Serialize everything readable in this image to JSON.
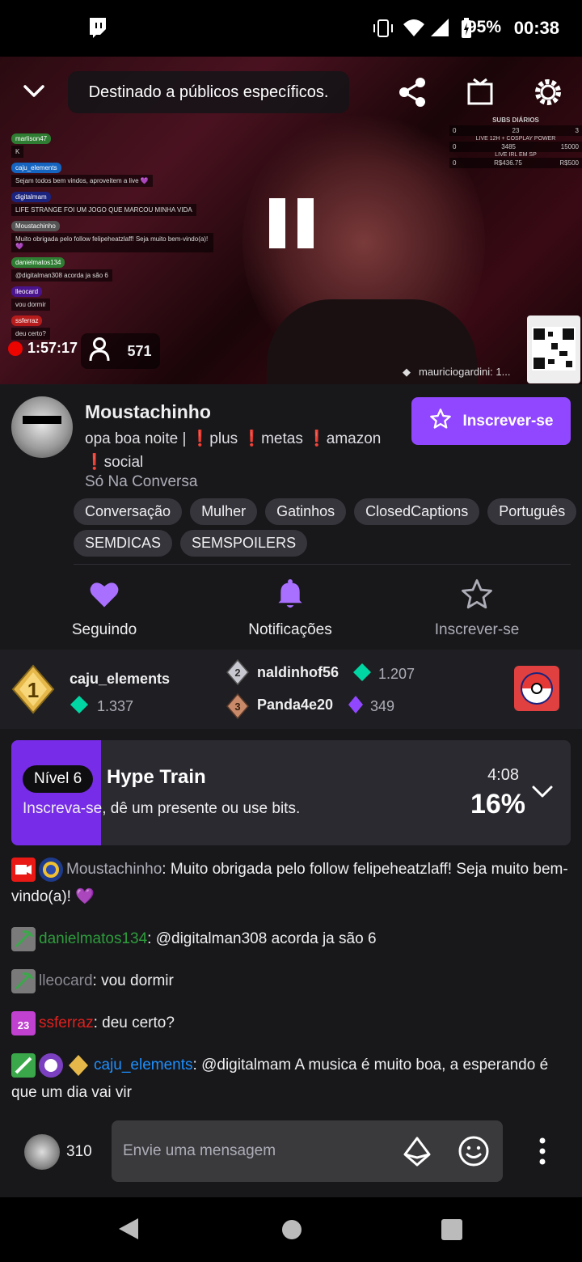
{
  "status_bar": {
    "battery": "95%",
    "time": "00:38"
  },
  "video": {
    "notice": "Destinado a públicos específicos.",
    "uptime": "1:57:17",
    "viewer_count": "571",
    "credit": "mauriciogardini: 1...",
    "overlay_chat": [
      {
        "name": "marlison47",
        "color": "#2e7d32",
        "msg": "K"
      },
      {
        "name": "caju_elements",
        "color": "#1565c0",
        "msg": "Sejam todos bem vindos, aproveitem a live 💜"
      },
      {
        "name": "digitalmam",
        "color": "#1a237e",
        "msg": "LIFE STRANGE FOI UM JOGO QUE MARCOU MINHA VIDA"
      },
      {
        "name": "Moustachinho",
        "color": "#555555",
        "msg": "Muito obrigada pelo follow felipeheatzlaff! Seja muito bem-vindo(a)! 💜"
      },
      {
        "name": "danielmatos134",
        "color": "#2e7d32",
        "msg": "@digitalman308 acorda ja são 6"
      },
      {
        "name": "lleocard",
        "color": "#4a148c",
        "msg": "vou dormir"
      },
      {
        "name": "ssferraz",
        "color": "#b71c1c",
        "msg": "deu certo?"
      }
    ],
    "subs_panel": {
      "title": "SUBS DIÁRIOS",
      "row1": [
        "0",
        "23",
        "3"
      ],
      "line2": "LIVE 12H + COSPLAY POWER",
      "row2": [
        "0",
        "3485",
        "15000"
      ],
      "line3": "LIVE IRL EM SP",
      "row3": [
        "0",
        "R$436.75",
        "R$500"
      ]
    }
  },
  "channel": {
    "name": "Moustachinho",
    "title": "opa boa noite | ❗plus ❗metas ❗amazon ❗social",
    "category": "Só Na Conversa",
    "subscribe_label": "Inscrever-se",
    "tags": [
      "Conversação",
      "Mulher",
      "Gatinhos",
      "ClosedCaptions",
      "Português",
      "SEMDICAS",
      "SEMSPOILERS"
    ]
  },
  "actions": {
    "following": "Seguindo",
    "notifications": "Notificações",
    "subscribe": "Inscrever-se"
  },
  "leaderboard": {
    "first": {
      "rank": "1",
      "name": "caju_elements",
      "value": "1.337"
    },
    "second": {
      "rank": "2",
      "name": "naldinhof56",
      "value": "1.207"
    },
    "third": {
      "rank": "3",
      "name": "Panda4e20",
      "value": "349"
    }
  },
  "hype_train": {
    "level": "Nível 6",
    "title": "Hype Train",
    "subtitle": "Inscreva-se, dê um presente ou use bits.",
    "timer": "4:08",
    "percent": "16%",
    "progress": 0.16
  },
  "chat": [
    {
      "user": "Moustachinho",
      "color": "#adadb8",
      "text": ": Muito obrigada pelo follow felipeheatzlaff! Seja muito bem-vindo(a)! 💜"
    },
    {
      "user": "danielmatos134",
      "color": "#2e9d3c",
      "text": ": @digitalman308 acorda ja são 6"
    },
    {
      "user": "lleocard",
      "color": "#8a8a92",
      "text": ": vou dormir"
    },
    {
      "user": "ssferraz",
      "color": "#e0201c",
      "text": ": deu certo?"
    },
    {
      "user": "caju_elements",
      "color": "#1e90ff",
      "text": ": @digitalmam A musica é muito boa, a esperando é que um dia vai vir"
    }
  ],
  "composer": {
    "points": "310",
    "placeholder": "Envie uma mensagem"
  },
  "colors": {
    "accent": "#9147ff",
    "background": "#18181b"
  }
}
